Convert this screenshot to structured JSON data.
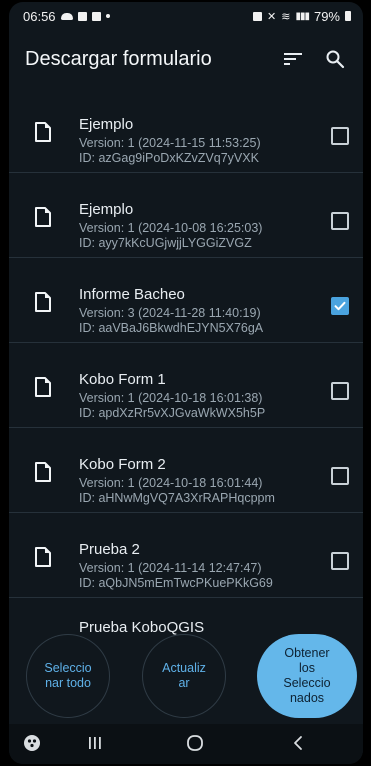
{
  "status": {
    "time": "06:56",
    "battery": "79%"
  },
  "appbar": {
    "title": "Descargar formulario"
  },
  "forms": [
    {
      "name": "Ejemplo",
      "version": "Version: 1 (2024-11-15 11:53:25)",
      "id": "ID: azGag9iPoDxKZvZVq7yVXK",
      "checked": false
    },
    {
      "name": "Ejemplo",
      "version": "Version: 1 (2024-10-08 16:25:03)",
      "id": "ID: ayy7kKcUGjwjjLYGGiZVGZ",
      "checked": false
    },
    {
      "name": "Informe Bacheo",
      "version": "Version: 3 (2024-11-28 11:40:19)",
      "id": "ID: aaVBaJ6BkwdhEJYN5X76gA",
      "checked": true
    },
    {
      "name": "Kobo Form 1",
      "version": "Version: 1 (2024-10-18 16:01:38)",
      "id": "ID: apdXzRr5vXJGvaWkWX5h5P",
      "checked": false
    },
    {
      "name": "Kobo Form 2",
      "version": "Version: 1 (2024-10-18 16:01:44)",
      "id": "ID: aHNwMgVQ7A3XrRAPHqcppm",
      "checked": false
    },
    {
      "name": "Prueba 2",
      "version": "Version: 1 (2024-11-14 12:47:47)",
      "id": "ID: aQbJN5mEmTwcPKuePKkG69",
      "checked": false
    }
  ],
  "partial_item": {
    "name": "Prueba KoboQGIS"
  },
  "buttons": {
    "select_all": {
      "line1": "Seleccio",
      "line2": "nar todo"
    },
    "refresh": {
      "line1": "Actualiz",
      "line2": "ar"
    },
    "get_selected": {
      "line1": "Obtener",
      "line2": "los",
      "line3": "Seleccio",
      "line4": "nados"
    }
  },
  "colors": {
    "background": "#10171d",
    "accent": "#64b7ea",
    "checked": "#4aa3df",
    "divider": "#26313a"
  }
}
